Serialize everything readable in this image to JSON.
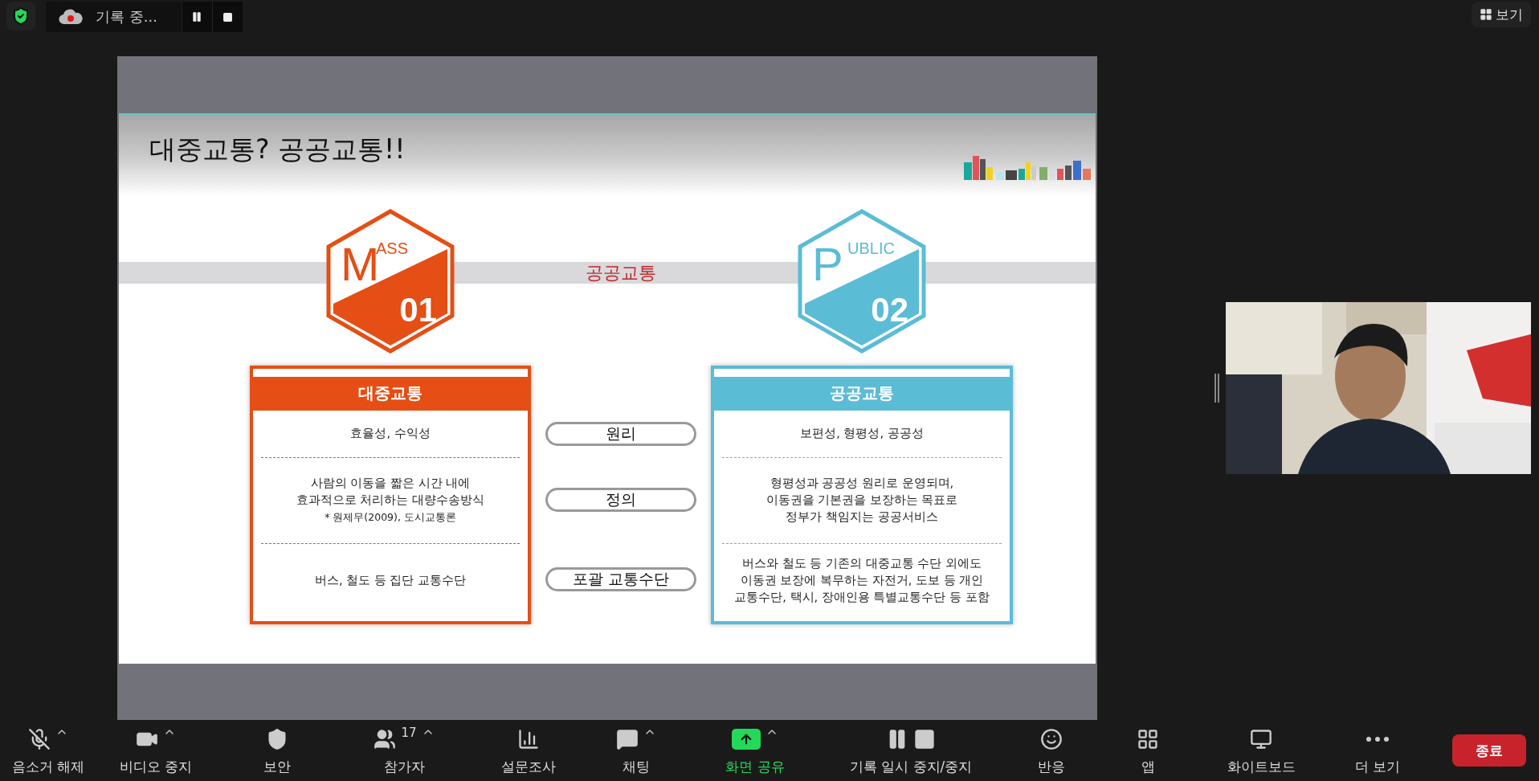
{
  "top_bar": {
    "recording": {
      "label": "기록 중..."
    },
    "view_button": {
      "label": "보기"
    }
  },
  "slide": {
    "title": "대중교통? 공공교통!!",
    "band_label": "공공교통",
    "hexagons": [
      {
        "letter": "M",
        "rest": "ASS",
        "number": "01",
        "color": "#e54e14"
      },
      {
        "letter": "P",
        "rest": "UBLIC",
        "number": "02",
        "color": "#5bbcd6"
      }
    ],
    "criteria": [
      "원리",
      "정의",
      "포괄 교통수단"
    ],
    "cards": [
      {
        "header": "대중교통",
        "color": "#e54e14",
        "rows": [
          {
            "lines": [
              "효율성, 수익성"
            ]
          },
          {
            "lines": [
              "사람의 이동을 짧은 시간 내에",
              "효과적으로 처리하는 대량수송방식"
            ],
            "note": "* 원제무(2009), 도시교통론"
          },
          {
            "lines": [
              "버스, 철도 등 집단 교통수단"
            ]
          }
        ]
      },
      {
        "header": "공공교통",
        "color": "#5bbcd6",
        "rows": [
          {
            "lines": [
              "보편성, 형평성, 공공성"
            ]
          },
          {
            "lines": [
              "형평성과 공공성 원리로 운영되며,",
              "이동권을 기본권을 보장하는 목표로",
              "정부가 책임지는 공공서비스"
            ]
          },
          {
            "lines": [
              "버스와 철도 등 기존의 대중교통 수단 외에도",
              "이동권 보장에 복무하는 자전거, 도보 등 개인",
              "교통수단, 택시, 장애인용 특별교통수단 등 포함"
            ]
          }
        ]
      }
    ]
  },
  "toolbar": {
    "items": [
      {
        "kind": "mic",
        "label": "음소거 해제",
        "muted": true,
        "caret": true
      },
      {
        "kind": "video",
        "label": "비디오 중지",
        "caret": true
      },
      {
        "kind": "security",
        "label": "보안"
      },
      {
        "kind": "participants",
        "label": "참가자",
        "count": "17",
        "caret": true
      },
      {
        "kind": "poll",
        "label": "설문조사"
      },
      {
        "kind": "chat",
        "label": "채팅",
        "caret": true
      },
      {
        "kind": "share",
        "label": "화면 공유",
        "active": true,
        "caret": true
      },
      {
        "kind": "record",
        "label": "기록 일시 중지/중지"
      },
      {
        "kind": "reaction",
        "label": "반응"
      },
      {
        "kind": "apps",
        "label": "앱"
      },
      {
        "kind": "whiteboard",
        "label": "화이트보드"
      },
      {
        "kind": "more",
        "label": "더 보기"
      }
    ],
    "end_button": "종료"
  }
}
